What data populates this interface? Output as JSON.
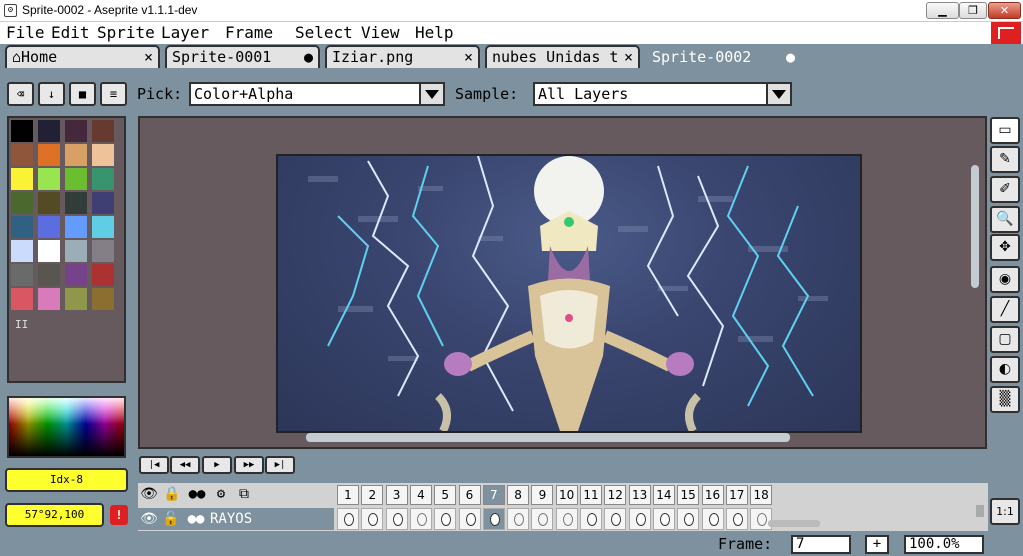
{
  "window": {
    "title": "Sprite-0002 - Aseprite v1.1.1-dev",
    "icon": "aseprite-icon"
  },
  "menu": [
    "File",
    "Edit",
    "Sprite",
    "Layer",
    "Frame",
    "Select",
    "View",
    "Help"
  ],
  "tabs": [
    {
      "label": "Home",
      "close": "×"
    },
    {
      "label": "Sprite-0001",
      "close": "●"
    },
    {
      "label": "Iziar.png",
      "close": "×"
    },
    {
      "label": "nubes Unidas t",
      "close": "×"
    },
    {
      "label": "Sprite-0002",
      "close": "●",
      "active": true
    }
  ],
  "context_bar": {
    "pick_label": "Pick:",
    "pick_value": "Color+Alpha",
    "sample_label": "Sample:",
    "sample_value": "All Layers"
  },
  "palette": {
    "colors": [
      "#000000",
      "#222034",
      "#45283c",
      "#663931",
      "#8f563b",
      "#df7126",
      "#d9a066",
      "#eec39a",
      "#fbf236",
      "#99e550",
      "#6abe30",
      "#37946e",
      "#4b692f",
      "#524b24",
      "#323c39",
      "#3f3f74",
      "#306082",
      "#5b6ee1",
      "#639bff",
      "#5fcde4",
      "#cbdbfc",
      "#ffffff",
      "#9badb7",
      "#847e87",
      "#696a6a",
      "#595652",
      "#76428a",
      "#ac3232",
      "#d95763",
      "#d77bba",
      "#8f974a",
      "#8a6f30"
    ],
    "page_indicator": "II"
  },
  "color_bar": {
    "fg_label": "Idx-8",
    "position_label": "57°92,100",
    "warning": "!"
  },
  "playback": [
    "|◀",
    "◀◀",
    "▶",
    "▶▶",
    "▶|"
  ],
  "timeline": {
    "header_icons": [
      "eye-icon",
      "lock-icon",
      "continuous-icon",
      "gear-icon",
      "onion-skin-icon"
    ],
    "frames": [
      "1",
      "2",
      "3",
      "4",
      "5",
      "6",
      "7",
      "8",
      "9",
      "10",
      "11",
      "12",
      "13",
      "14",
      "15",
      "16",
      "17",
      "18"
    ],
    "current_frame_index": 6,
    "layer": {
      "name": "RAYOS",
      "visible_icon": "eye-icon",
      "lock_icon": "unlock-icon",
      "continuous_icon": "continuous-icon"
    },
    "cels": [
      "full",
      "full",
      "full",
      "empty",
      "full",
      "full",
      "full",
      "empty",
      "empty",
      "empty",
      "full",
      "full",
      "full",
      "full",
      "full",
      "full",
      "full",
      "empty"
    ]
  },
  "tools": [
    "▭",
    "✎",
    "✐",
    "🔍",
    "✥",
    "◉",
    "╱",
    "▢",
    "◐",
    "▒"
  ],
  "zoom_button": "1:1",
  "status": {
    "frame_label": "Frame:",
    "frame_value": "7",
    "plus": "+",
    "zoom_value": "100.0%"
  }
}
